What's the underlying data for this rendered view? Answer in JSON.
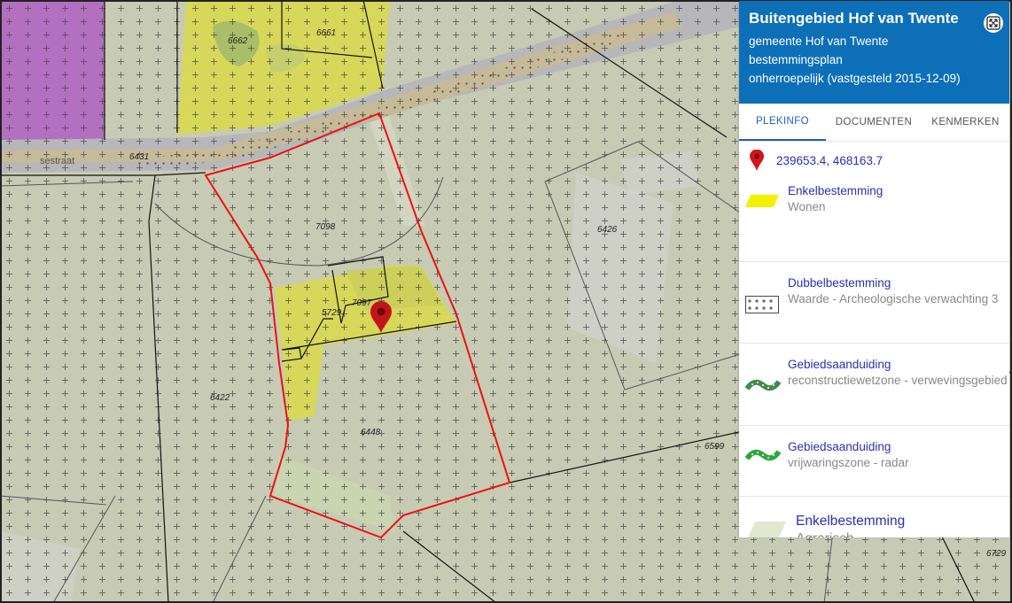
{
  "map": {
    "street": "sestraat",
    "parcels": [
      "6662",
      "6661",
      "6431",
      "7098",
      "6426",
      "5729",
      "7097",
      "6422",
      "6448",
      "6599",
      "6729"
    ]
  },
  "panel": {
    "title": "Buitengebied Hof van Twente",
    "municipality": "gemeente Hof van Twente",
    "plan_type": "bestemmingsplan",
    "status": "onherroepelijk (vastgesteld 2015-12-09)",
    "expand_icon": "expand-icon",
    "tabs": [
      {
        "label": "PLEKINFO",
        "active": true
      },
      {
        "label": "DOCUMENTEN",
        "active": false
      },
      {
        "label": "KENMERKEN",
        "active": false
      }
    ],
    "coordinates": "239653.4, 468163.7",
    "items": [
      {
        "title": "Enkelbestemming",
        "value": "Wonen",
        "symbol": "yellow-parallelogram",
        "color": "#f5f000"
      },
      {
        "title": "Dubbelbestemming",
        "value": "Waarde - Archeologische verwachting 3",
        "symbol": "cross-hatch-box"
      },
      {
        "title": "Gebiedsaanduiding",
        "value": "reconstructiewetzone - verwevingsgebied",
        "symbol": "green-dotted-band",
        "color": "#3f8a4e"
      },
      {
        "title": "Gebiedsaanduiding",
        "value": "vrijwaringszone - radar",
        "symbol": "green-dotted-band",
        "color": "#2aa83a"
      },
      {
        "title": "Enkelbestemming",
        "value": "Agrarisch",
        "symbol": "pale-green-parallelogram",
        "color": "#e1e8cf"
      }
    ]
  },
  "colors": {
    "agrarisch": "#c7cbb4",
    "wonen": "#d7d75a",
    "road": "#b7b7ba",
    "purple": "#b36fc0",
    "selection": "#e11",
    "header": "#0d6fb8",
    "link": "#2a2fb0"
  }
}
